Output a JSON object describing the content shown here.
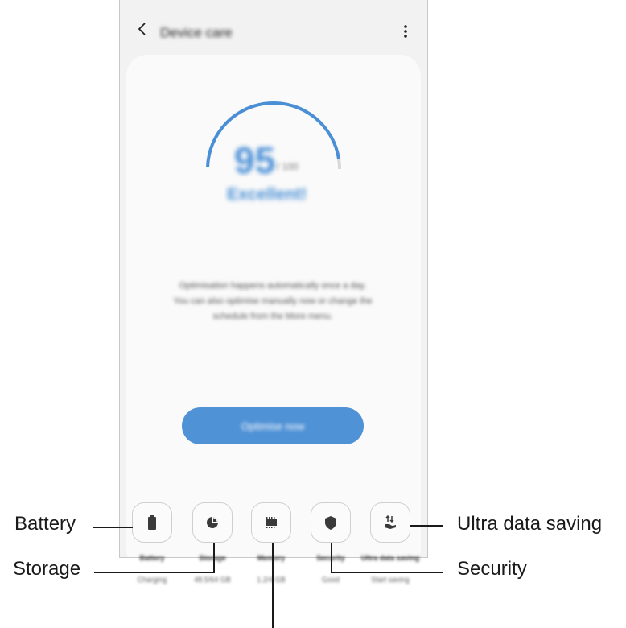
{
  "header": {
    "title": "Device care"
  },
  "score": {
    "value": "95",
    "max_label": "/ 100",
    "status": "Excellent!",
    "fraction": 0.95,
    "color": "#4a8fd6"
  },
  "description": [
    "Optimisation happens automatically once a day.",
    "You can also optimise manually now or change the",
    "schedule from the More menu."
  ],
  "optimize_button": {
    "label": "Optimise now",
    "color": "#5092d6"
  },
  "modules": [
    {
      "name": "Battery",
      "value": "Charging",
      "icon": "battery-icon"
    },
    {
      "name": "Storage",
      "value": "48.5/64 GB",
      "icon": "pie-chart-icon"
    },
    {
      "name": "Memory",
      "value": "1.2/4 GB",
      "icon": "memory-chip-icon"
    },
    {
      "name": "Security",
      "value": "Good",
      "icon": "shield-icon"
    },
    {
      "name": "Ultra data saving",
      "value": "Start saving",
      "icon": "data-saving-icon"
    }
  ],
  "callouts": {
    "battery": "Battery",
    "storage": "Storage",
    "ultra_data_saving": "Ultra data saving",
    "security": "Security"
  }
}
